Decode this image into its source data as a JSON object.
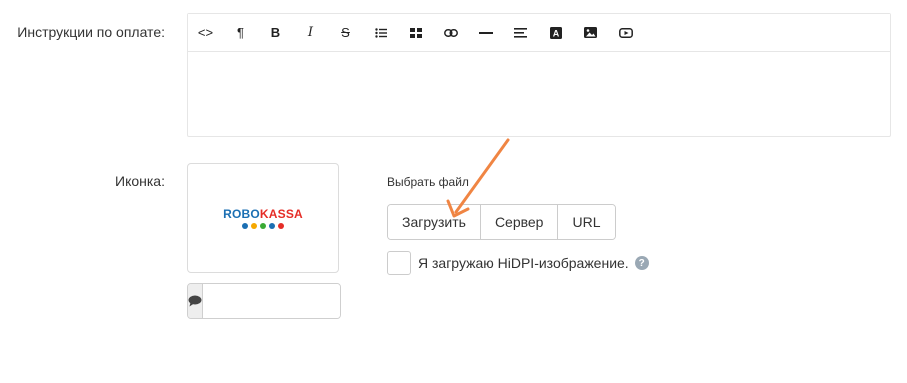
{
  "labels": {
    "instructions": "Инструкции по оплате:",
    "icon": "Иконка:",
    "choose_file": "Выбрать файл"
  },
  "toolbar": {
    "buttons": [
      {
        "name": "code-view-button",
        "glyph": "<>"
      },
      {
        "name": "paragraph-button",
        "glyph": "¶"
      },
      {
        "name": "bold-button",
        "glyph": "B"
      },
      {
        "name": "italic-button",
        "glyph": "I"
      },
      {
        "name": "strikethrough-button",
        "glyph": "S"
      },
      {
        "name": "unordered-list-button",
        "glyph": "☰"
      },
      {
        "name": "table-button",
        "glyph": "▦"
      },
      {
        "name": "link-button",
        "glyph": "🔗"
      },
      {
        "name": "horizontal-rule-button",
        "glyph": "—"
      },
      {
        "name": "align-button",
        "glyph": "≡"
      },
      {
        "name": "font-color-button",
        "glyph": "A"
      },
      {
        "name": "image-button",
        "glyph": "🖼"
      },
      {
        "name": "video-button",
        "glyph": "▶"
      }
    ]
  },
  "logo": {
    "part1": "ROBO",
    "part2": "KASSA",
    "colors": [
      "#1b6fb3",
      "#e52d27",
      "#f6a800",
      "#3aaa35",
      "#1b6fb3",
      "#e52d27"
    ]
  },
  "comment_input": {
    "value": "",
    "placeholder": ""
  },
  "upload_buttons": {
    "upload": "Загрузить",
    "server": "Сервер",
    "url": "URL"
  },
  "hidpi": {
    "label": "Я загружаю HiDPI-изображение.",
    "help": "?"
  },
  "colors": {
    "arrow": "#f08543"
  }
}
